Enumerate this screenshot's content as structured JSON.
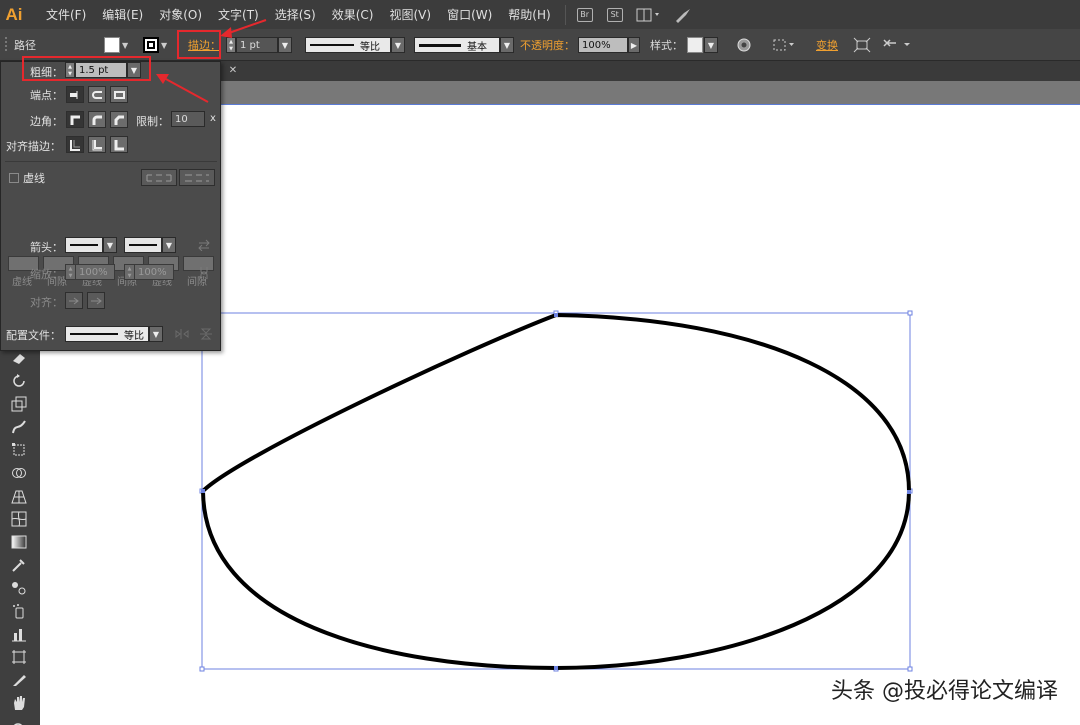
{
  "app": {
    "logo": "Ai"
  },
  "menu": {
    "items": [
      "文件(F)",
      "编辑(E)",
      "对象(O)",
      "文字(T)",
      "选择(S)",
      "效果(C)",
      "视图(V)",
      "窗口(W)",
      "帮助(H)"
    ]
  },
  "menubar_icons": {
    "br_label": "Br",
    "st_label": "St"
  },
  "control_bar": {
    "selection_type": "路径",
    "fill_color": "#ffffff",
    "stroke_color": "#000000",
    "stroke_label": "描边：",
    "stroke_weight": "1 pt",
    "profile_label": "等比",
    "brush_label": "基本",
    "opacity_label": "不透明度：",
    "opacity_value": "100%",
    "style_label": "样式：",
    "transform_label": "变换"
  },
  "stroke_panel": {
    "weight_label": "粗细：",
    "weight_value": "1.5 pt",
    "cap_label": "端点：",
    "corner_label": "边角：",
    "limit_label": "限制：",
    "limit_value": "10",
    "limit_unit": "x",
    "align_label": "对齐描边：",
    "dashed_label": "虚线",
    "dash_labels": [
      "虚线",
      "间隙",
      "虚线",
      "间隙",
      "虚线",
      "间隙"
    ],
    "arrowheads_label": "箭头：",
    "scale_label": "缩放：",
    "scale_start": "100%",
    "scale_end": "100%",
    "align_arrow_label": "对齐：",
    "profile_label": "配置文件：",
    "profile_value": "等比"
  },
  "annotations": {
    "highlight_color": "#e5282d"
  },
  "watermark": "头条 @投必得论文编译"
}
